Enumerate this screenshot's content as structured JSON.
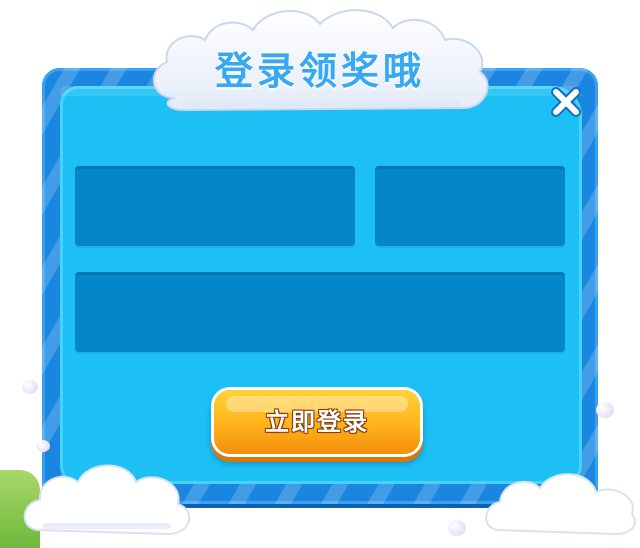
{
  "dialog": {
    "title": "登录领奖哦",
    "close_icon": "close-x-icon",
    "login_button_label": "立即登录"
  },
  "form": {
    "phone": {
      "value": "",
      "placeholder": ""
    },
    "code": {
      "value": "",
      "placeholder": ""
    },
    "password": {
      "value": "",
      "placeholder": ""
    }
  },
  "colors": {
    "frame": "#1a86e0",
    "panel": "#1cc0f4",
    "field": "#0387ca",
    "title": "#38a8f2",
    "button": "#ffb21b"
  }
}
